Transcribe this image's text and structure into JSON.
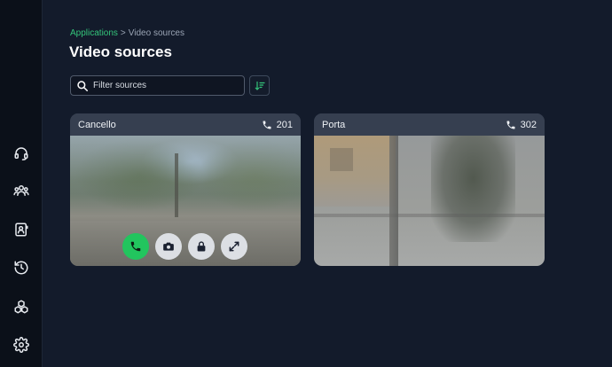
{
  "breadcrumb": {
    "parent": "Applications",
    "separator": ">",
    "current": "Video sources"
  },
  "page_title": "Video sources",
  "search": {
    "placeholder": "Filter sources",
    "value": ""
  },
  "sidebar": {
    "items": [
      {
        "icon": "headset-icon"
      },
      {
        "icon": "users-icon"
      },
      {
        "icon": "contacts-icon"
      },
      {
        "icon": "history-icon"
      },
      {
        "icon": "apps-icon"
      },
      {
        "icon": "gear-icon"
      }
    ]
  },
  "sources": [
    {
      "name": "Cancello",
      "extension": "201",
      "controls": [
        "call-icon",
        "camera-icon",
        "lock-icon",
        "expand-icon"
      ]
    },
    {
      "name": "Porta",
      "extension": "302",
      "controls": []
    }
  ],
  "colors": {
    "accent": "#34c47a",
    "call_button": "#22c55e",
    "background": "#131b2b",
    "sidebar": "#0b1019"
  }
}
